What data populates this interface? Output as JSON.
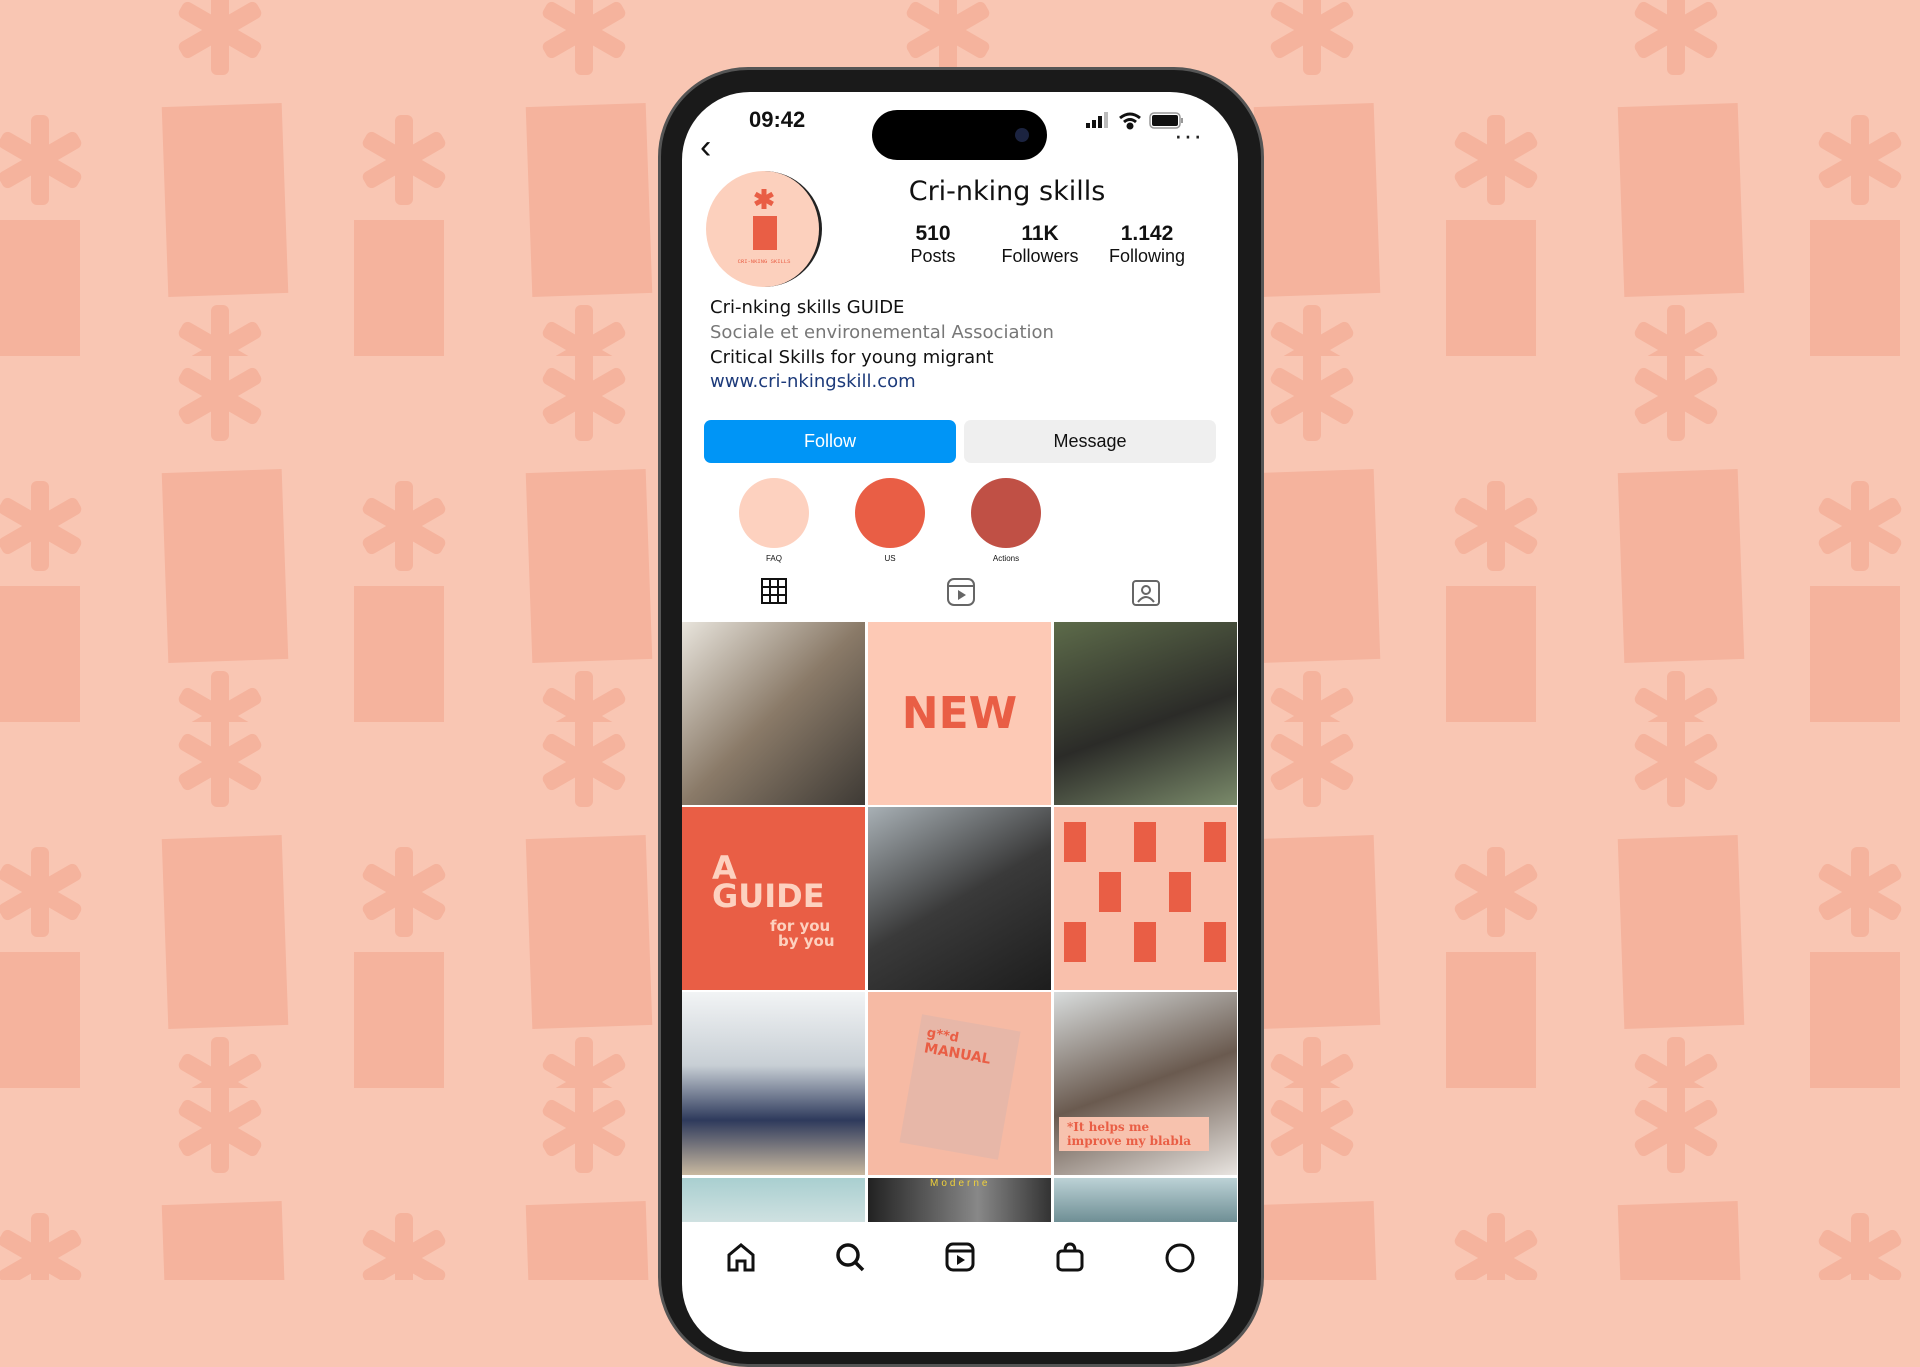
{
  "colors": {
    "background": "#f9c6b3",
    "pattern": "#f5b39d",
    "follow": "#0095f6",
    "coral": "#e95e45",
    "dark_coral": "#c05045",
    "light_peach": "#fdd1bf"
  },
  "status_bar": {
    "time": "09:42",
    "icons": [
      "signal-icon",
      "wifi-icon",
      "battery-icon"
    ]
  },
  "profile": {
    "username": "Cri-nking skills",
    "avatar_text": "CRI-NKING SKILLS",
    "stats": [
      {
        "value": "510",
        "label": "Posts"
      },
      {
        "value": "11K",
        "label": "Followers"
      },
      {
        "value": "1.142",
        "label": "Following"
      }
    ],
    "bio": {
      "name": "Cri-nking skills GUIDE",
      "category": "Sociale et environemental Association",
      "description": "Critical Skills for young migrant",
      "link": "www.cri-nkingskill.com"
    }
  },
  "actions": {
    "follow": "Follow",
    "message": "Message"
  },
  "highlights": [
    {
      "label": "FAQ",
      "color": "#fdd1bf"
    },
    {
      "label": "US",
      "color": "#e95e45"
    },
    {
      "label": "Actions",
      "color": "#c05045"
    }
  ],
  "tabs": [
    "grid-icon",
    "reels-icon",
    "tagged-icon"
  ],
  "grid": {
    "new": "NEW",
    "guide": {
      "a": "A",
      "title": "GUIDE",
      "sub1": "for you",
      "sub2": "by you"
    },
    "manual": {
      "top": "g**d",
      "bottom": "MANUAL"
    },
    "quote": {
      "line1": "*It helps me",
      "line2": "improve my blabla"
    },
    "moderne": "Moderne"
  },
  "bottom_nav": [
    "home-icon",
    "search-icon",
    "reels-icon",
    "shop-icon",
    "profile-icon"
  ]
}
